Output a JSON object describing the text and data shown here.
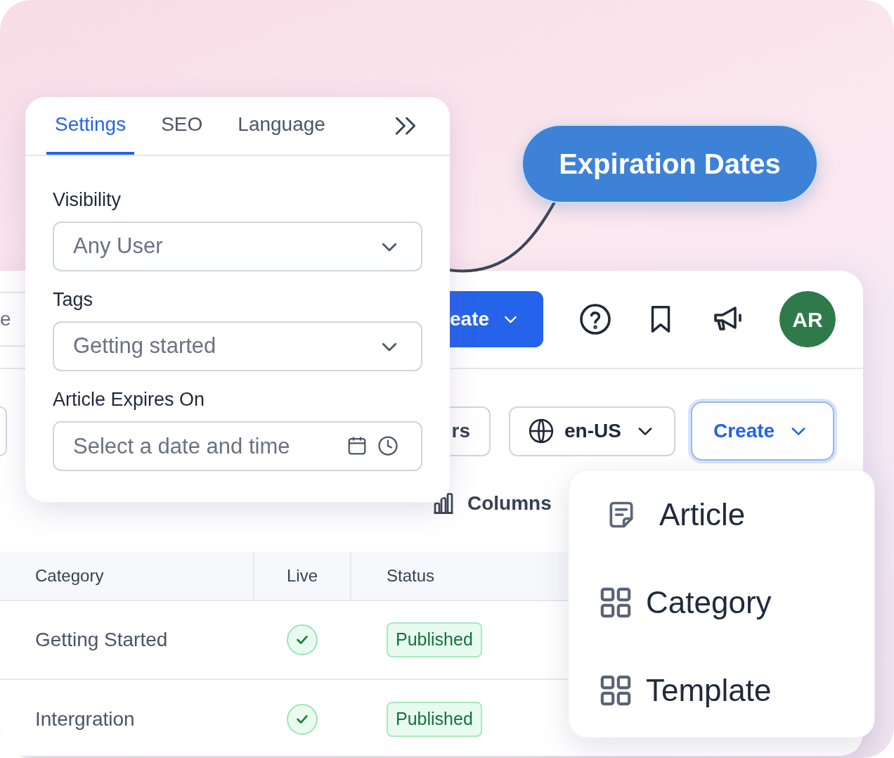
{
  "callout": {
    "label": "Expiration Dates"
  },
  "settings_panel": {
    "tabs": [
      {
        "label": "Settings",
        "selected": true
      },
      {
        "label": "SEO",
        "selected": false
      },
      {
        "label": "Language",
        "selected": false
      }
    ],
    "fields": [
      {
        "kind": "select",
        "label": "Visibility",
        "value": "Any User"
      },
      {
        "kind": "select",
        "label": "Tags",
        "value": "Getting started"
      },
      {
        "kind": "datetime",
        "label": "Article Expires On",
        "placeholder": "Select a date and time"
      }
    ]
  },
  "app": {
    "search_partial": "e",
    "create_button": "eate",
    "avatar": "AR",
    "filters_partial": "rs",
    "locale": "en-US",
    "create_menu_button": {
      "label": "Create",
      "expanded": true
    },
    "columns_button": "Columns",
    "table": {
      "columns": [
        "Category",
        "Live",
        "Status"
      ],
      "rows": [
        {
          "category": "Getting Started",
          "live": true,
          "status": "Published"
        },
        {
          "category": "Intergration",
          "live": true,
          "status": "Published"
        }
      ]
    }
  },
  "create_menu": {
    "items": [
      {
        "label": "Article",
        "kind": "article"
      },
      {
        "label": "Category",
        "kind": "grid"
      },
      {
        "label": "Template",
        "kind": "grid"
      }
    ]
  }
}
